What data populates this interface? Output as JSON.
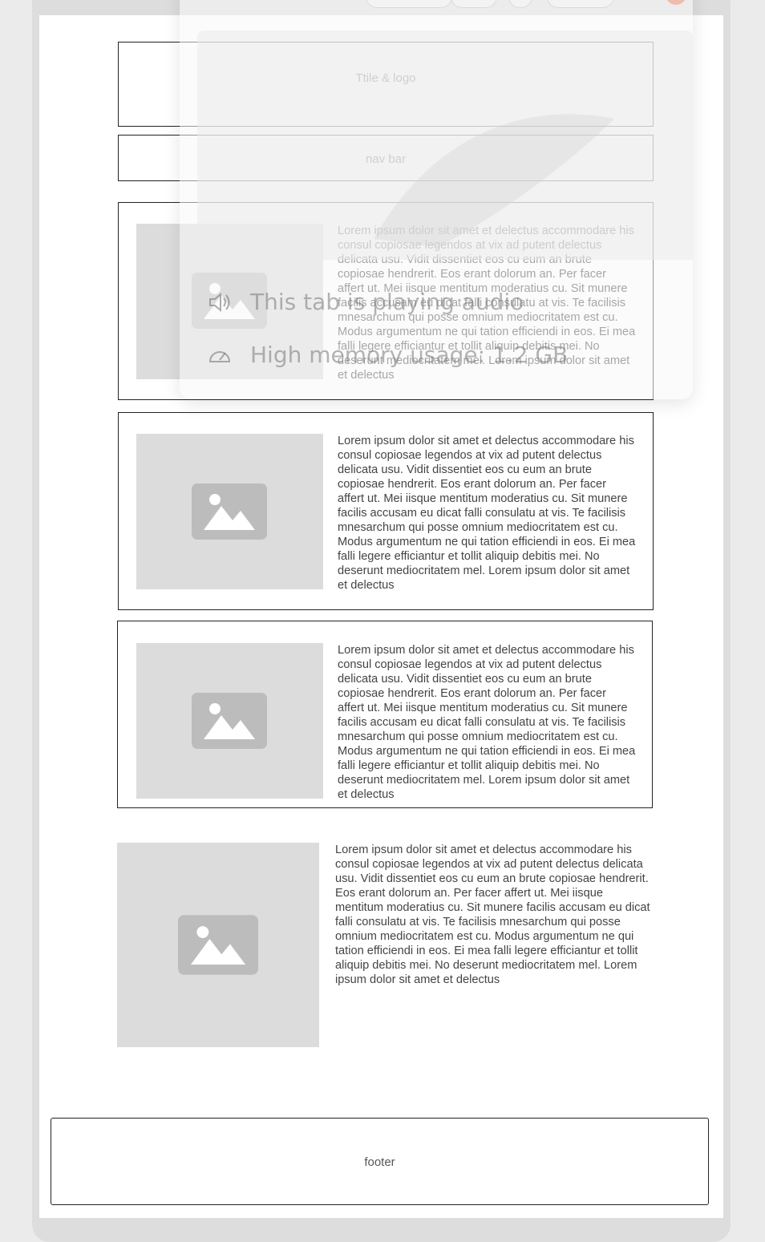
{
  "header": {
    "title_logo": "Ttile & logo"
  },
  "nav": {
    "label": "nav bar"
  },
  "articles": [
    {
      "text": "Lorem ipsum dolor sit amet et delectus accommodare his consul copiosae legendos at vix ad putent delectus delicata usu. Vidit dissentiet eos cu eum an brute copiosae hendrerit. Eos erant dolorum an. Per facer affert ut. Mei iisque mentitum moderatius cu. Sit munere facilis accusam eu dicat falli consulatu at vis. Te facilisis mnesarchum qui posse omnium mediocritatem est cu. Modus argumentum ne qui tation efficiendi in eos. Ei mea falli legere efficiantur et tollit aliquip debitis mei. No deserunt mediocritatem mel. Lorem ipsum dolor sit amet et delectus"
    },
    {
      "text": "Lorem ipsum dolor sit amet et delectus accommodare his consul copiosae legendos at vix ad putent delectus delicata usu. Vidit dissentiet eos cu eum an brute copiosae hendrerit. Eos erant dolorum an. Per facer affert ut. Mei iisque mentitum moderatius cu. Sit munere facilis accusam eu dicat falli consulatu at vis. Te facilisis mnesarchum qui posse omnium mediocritatem est cu. Modus argumentum ne qui tation efficiendi in eos. Ei mea falli legere efficiantur et tollit aliquip debitis mei. No deserunt mediocritatem mel. Lorem ipsum dolor sit amet et delectus"
    },
    {
      "text": "Lorem ipsum dolor sit amet et delectus accommodare his consul copiosae legendos at vix ad putent delectus delicata usu. Vidit dissentiet eos cu eum an brute copiosae hendrerit. Eos erant dolorum an. Per facer affert ut. Mei iisque mentitum moderatius cu. Sit munere facilis accusam eu dicat falli consulatu at vis. Te facilisis mnesarchum qui posse omnium mediocritatem est cu. Modus argumentum ne qui tation efficiendi in eos. Ei mea falli legere efficiantur et tollit aliquip debitis mei. No deserunt mediocritatem mel. Lorem ipsum dolor sit amet et delectus"
    },
    {
      "text": "Lorem ipsum dolor sit amet et delectus accommodare his consul copiosae legendos at vix ad putent delectus delicata usu. Vidit dissentiet eos cu eum an brute copiosae hendrerit. Eos erant dolorum an. Per facer affert ut. Mei iisque mentitum moderatius cu. Sit munere facilis accusam eu dicat falli consulatu at vis. Te facilisis mnesarchum qui posse omnium mediocritatem est cu. Modus argumentum ne qui tation efficiendi in eos. Ei mea falli legere efficiantur et tollit aliquip debitis mei. No deserunt mediocritatem mel. Lorem ipsum dolor sit amet et delectus"
    }
  ],
  "footer": {
    "label": "footer"
  },
  "tab_tooltip": {
    "audio_text": "This tab is playing audio",
    "memory_text": "High memory usage: 1.2 GB",
    "audio_icon": "speaker-icon",
    "memory_icon": "gauge-icon"
  },
  "colors": {
    "placeholder_bg": "#dcdcdc",
    "placeholder_icon": "#bcbcbc",
    "border": "#222222"
  }
}
